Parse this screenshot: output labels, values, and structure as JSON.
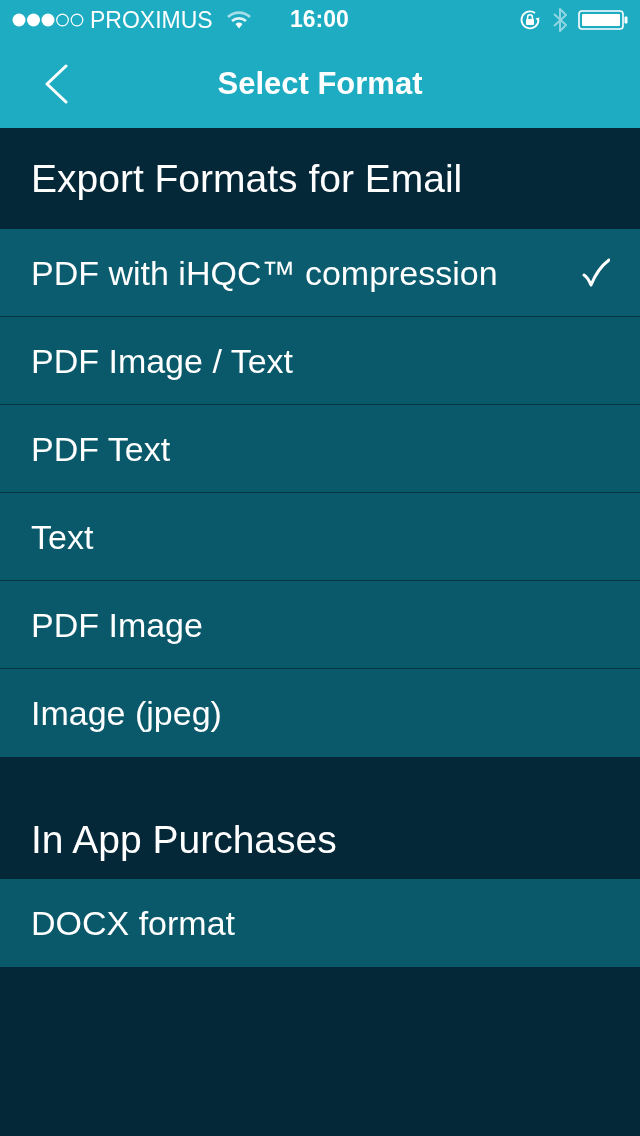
{
  "status_bar": {
    "carrier": "PROXIMUS",
    "time": "16:00"
  },
  "nav_bar": {
    "title": "Select Format"
  },
  "sections": [
    {
      "title": "Export Formats for Email",
      "items": [
        {
          "label": "PDF with iHQC™ compression",
          "selected": true
        },
        {
          "label": "PDF Image / Text",
          "selected": false
        },
        {
          "label": "PDF Text",
          "selected": false
        },
        {
          "label": "Text",
          "selected": false
        },
        {
          "label": "PDF Image",
          "selected": false
        },
        {
          "label": "Image (jpeg)",
          "selected": false
        }
      ]
    },
    {
      "title": "In App Purchases",
      "items": [
        {
          "label": "DOCX format",
          "selected": false
        }
      ]
    }
  ]
}
